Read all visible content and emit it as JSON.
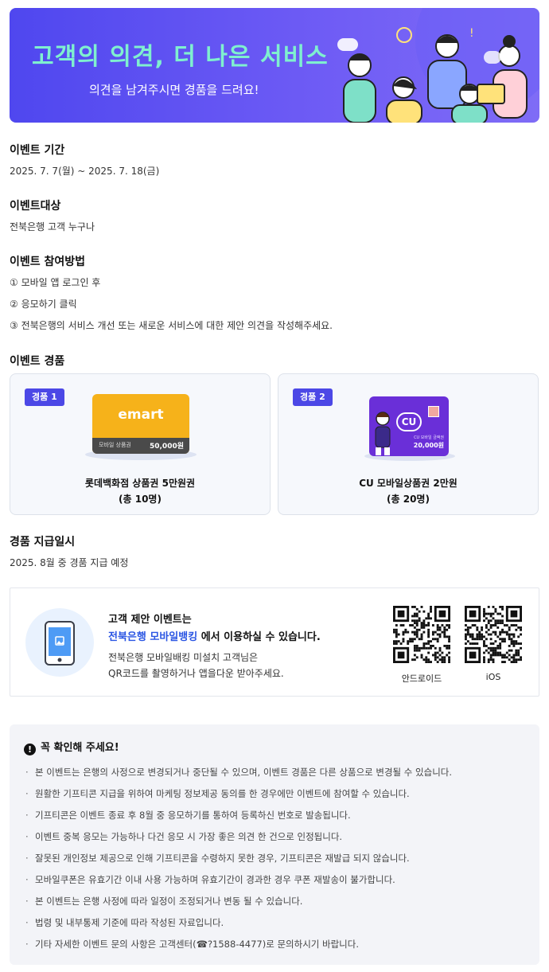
{
  "banner": {
    "title": "고객의 의견, 더 나은 서비스",
    "subtitle": "의견을 남겨주시면 경품을 드려요!"
  },
  "period": {
    "title": "이벤트 기간",
    "text": "2025. 7. 7(월) ~ 2025. 7. 18(금)"
  },
  "target": {
    "title": "이벤트대상",
    "text": "전북은행 고객 누구나"
  },
  "howto": {
    "title": "이벤트 참여방법",
    "steps": [
      "① 모바일 앱 로그인 후",
      "② 응모하기 클릭",
      "③ 전북은행의 서비스 개선 또는 새로운 서비스에 대한 제안 의견을 작성해주세요."
    ]
  },
  "prizes": {
    "title": "이벤트 경품",
    "items": [
      {
        "badge": "경품 1",
        "name": "롯데백화점 상품권 5만원권",
        "count": "(총 10명)",
        "card_brand": "emart",
        "card_label": "모바일 상품권",
        "card_amount": "50,000원",
        "color": "#f6b21a"
      },
      {
        "badge": "경품 2",
        "name": "CU 모바일상품권 2만원",
        "count": "(총 20명)",
        "card_brand": "CU",
        "card_label": "CU 모바일 금액권",
        "card_amount": "20,000원",
        "color": "#6a2fd8"
      }
    ]
  },
  "payout": {
    "title": "경품 지급일시",
    "text": "2025. 8월 중 경품 지급 예정"
  },
  "app": {
    "line1": "고객 제안 이벤트는",
    "line2_highlight": "전북은행 모바일뱅킹",
    "line2_rest": " 에서 이용하실 수 있습니다.",
    "line3": "전북은행 모바일배킹 미설치 고객님은",
    "line4": "QR코드를 촬영하거나 앱을다운 받아주세요.",
    "qr_android": "안드로이드",
    "qr_ios": "iOS"
  },
  "notice": {
    "title": "꼭 확인해 주세요!",
    "items": [
      "본 이벤트는 은행의 사정으로 변경되거나 중단될 수 있으며, 이벤트 경품은 다른 상품으로 변경될 수 있습니다.",
      "원활한 기프티콘 지급을 위하여 마케팅 정보제공 동의를 한 경우에만 이벤트에 참여할 수 있습니다.",
      "기프티콘은 이벤트 종료 후 8월 중 응모하기를 통하여 등록하신 번호로 발송됩니다.",
      "이벤트 중복 응모는 가능하나 다건 응모 시 가장 좋은 의견 한 건으로 인정됩니다.",
      "잘못된 개인정보 제공으로 인해 기프티콘을 수령하지 못한 경우, 기프티콘은 재발급 되지 않습니다.",
      "모바일쿠폰은 유효기간 이내 사용 가능하며 유효기간이 경과한 경우 쿠폰 재발송이 불가합니다.",
      "본 이벤트는 은행 사정에 따라 일정이 조정되거나 변동 될 수 있습니다.",
      "법령 및 내부통제 기준에 따라 작성된 자료입니다.",
      "기타 자세한 이벤트 문의 사항은 고객센터(☎?1588-4477)로 문의하시기 바랍니다."
    ]
  },
  "colors": {
    "banner": "#5b4ff2",
    "banner_title": "#7ff0cf",
    "badge": "#4c48e6",
    "highlight": "#2a55e3"
  }
}
